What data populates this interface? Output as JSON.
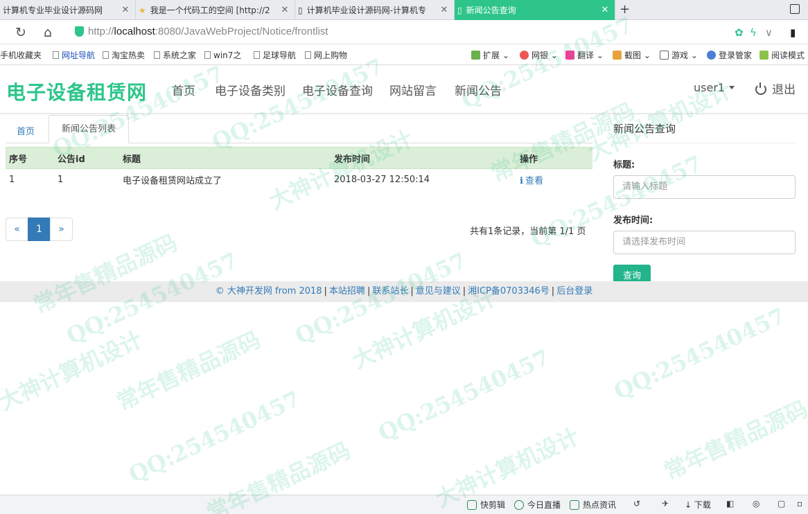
{
  "browser": {
    "tabs": [
      {
        "title": "计算机专业毕业设计源码网",
        "active": false
      },
      {
        "title": "我是一个代码工的空间 [http://2",
        "active": false
      },
      {
        "title": "计算机毕业设计源码网-计算机专",
        "active": false
      },
      {
        "title": "新闻公告查询",
        "active": true
      }
    ],
    "new_tab": "+",
    "url_prefix": "http://",
    "url_host": "localhost",
    "url_path": ":8080/JavaWebProject/Notice/frontlist",
    "bookmarks": [
      "手机收藏夹",
      "网址导航",
      "淘宝热卖",
      "系统之家",
      "win7之",
      "足球导航",
      "网上购物"
    ],
    "toolbar": [
      "扩展",
      "网银",
      "翻译",
      "截图",
      "游戏",
      "登录管家",
      "阅读模式"
    ]
  },
  "site": {
    "brand": "电子设备租赁网",
    "nav": [
      "首页",
      "电子设备类别",
      "电子设备查询",
      "网站留言",
      "新闻公告"
    ],
    "user": "user1",
    "logout": "退出"
  },
  "breadcrumb": {
    "home": "首页",
    "current": "新闻公告列表"
  },
  "table": {
    "headers": [
      "序号",
      "公告id",
      "标题",
      "发布时间",
      "操作"
    ],
    "rows": [
      {
        "index": "1",
        "id": "1",
        "title": "电子设备租赁网站成立了",
        "time": "2018-03-27 12:50:14",
        "action": "查看"
      }
    ]
  },
  "pagination": {
    "prev": "«",
    "current": "1",
    "next": "»",
    "info": "共有1条记录，当前第 1/1 页"
  },
  "search": {
    "panel_title": "新闻公告查询",
    "title_label": "标题:",
    "title_placeholder": "请输入标题",
    "time_label": "发布时间:",
    "time_placeholder": "请选择发布时间",
    "submit": "查询"
  },
  "footer": {
    "copyright": "© 大神开发网 from 2018",
    "links": [
      "本站招聘",
      "联系站长",
      "意见与建议",
      "湘ICP备0703346号",
      "后台登录"
    ]
  },
  "watermark": {
    "qq": "QQ:254540457",
    "line_a": "常年售精品源码",
    "line_b": "大神计算机设计"
  },
  "statusbar": [
    "快剪辑",
    "今日直播",
    "热点资讯",
    "下载"
  ],
  "colors": {
    "brand": "#2ec58a",
    "active_tab": "#2ec58a",
    "table_header": "#dbeed8",
    "link": "#337ab7",
    "button": "#24b48b"
  }
}
